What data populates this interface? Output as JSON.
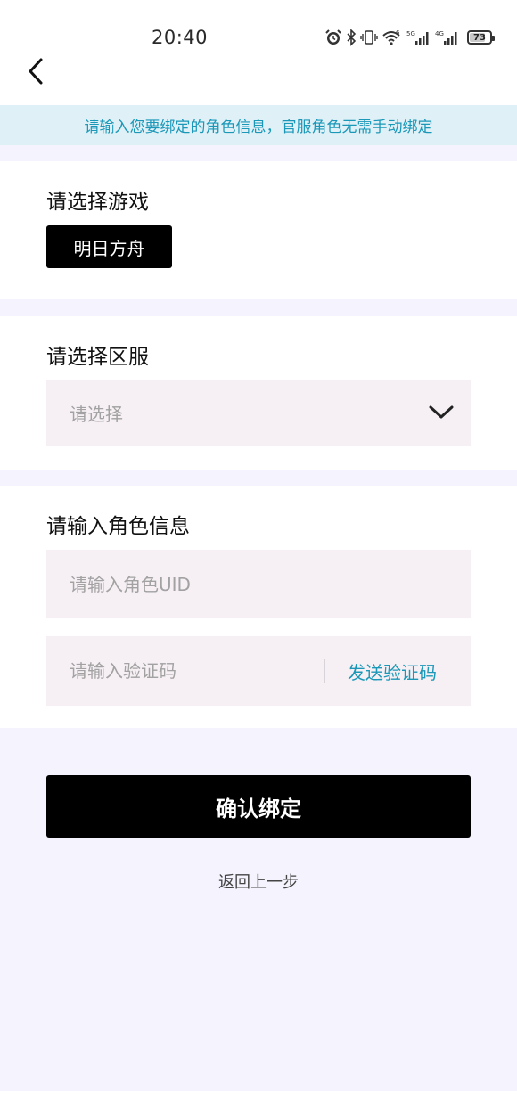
{
  "status_bar": {
    "time": "20:40",
    "battery": "73",
    "network_5g": "5G",
    "network_4g": "4G",
    "wifi_badge": "6"
  },
  "header": {
    "back_icon": "chevron-left-icon"
  },
  "notice": {
    "text": "请输入您要绑定的角色信息，官服角色无需手动绑定",
    "color": "#1b98b8",
    "background": "#dff0f7"
  },
  "game_section": {
    "title": "请选择游戏",
    "selected_game": "明日方舟"
  },
  "server_section": {
    "title": "请选择区服",
    "placeholder": "请选择",
    "dropdown_icon": "chevron-down-icon"
  },
  "role_section": {
    "title": "请输入角色信息",
    "uid_placeholder": "请输入角色UID",
    "code_placeholder": "请输入验证码",
    "send_code_label": "发送验证码"
  },
  "actions": {
    "confirm_label": "确认绑定",
    "back_label": "返回上一步"
  },
  "colors": {
    "accent": "#1b98b8",
    "primary_button": "#000000",
    "page_background": "#f5f3fd",
    "input_background": "#f6f0f4"
  }
}
